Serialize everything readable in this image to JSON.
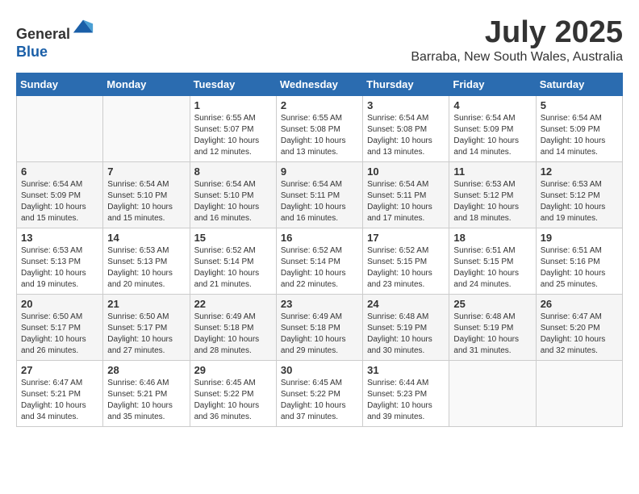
{
  "header": {
    "logo_line1": "General",
    "logo_line2": "Blue",
    "month_year": "July 2025",
    "location": "Barraba, New South Wales, Australia"
  },
  "weekdays": [
    "Sunday",
    "Monday",
    "Tuesday",
    "Wednesday",
    "Thursday",
    "Friday",
    "Saturday"
  ],
  "weeks": [
    [
      {
        "day": "",
        "info": ""
      },
      {
        "day": "",
        "info": ""
      },
      {
        "day": "1",
        "info": "Sunrise: 6:55 AM\nSunset: 5:07 PM\nDaylight: 10 hours and 12 minutes."
      },
      {
        "day": "2",
        "info": "Sunrise: 6:55 AM\nSunset: 5:08 PM\nDaylight: 10 hours and 13 minutes."
      },
      {
        "day": "3",
        "info": "Sunrise: 6:54 AM\nSunset: 5:08 PM\nDaylight: 10 hours and 13 minutes."
      },
      {
        "day": "4",
        "info": "Sunrise: 6:54 AM\nSunset: 5:09 PM\nDaylight: 10 hours and 14 minutes."
      },
      {
        "day": "5",
        "info": "Sunrise: 6:54 AM\nSunset: 5:09 PM\nDaylight: 10 hours and 14 minutes."
      }
    ],
    [
      {
        "day": "6",
        "info": "Sunrise: 6:54 AM\nSunset: 5:09 PM\nDaylight: 10 hours and 15 minutes."
      },
      {
        "day": "7",
        "info": "Sunrise: 6:54 AM\nSunset: 5:10 PM\nDaylight: 10 hours and 15 minutes."
      },
      {
        "day": "8",
        "info": "Sunrise: 6:54 AM\nSunset: 5:10 PM\nDaylight: 10 hours and 16 minutes."
      },
      {
        "day": "9",
        "info": "Sunrise: 6:54 AM\nSunset: 5:11 PM\nDaylight: 10 hours and 16 minutes."
      },
      {
        "day": "10",
        "info": "Sunrise: 6:54 AM\nSunset: 5:11 PM\nDaylight: 10 hours and 17 minutes."
      },
      {
        "day": "11",
        "info": "Sunrise: 6:53 AM\nSunset: 5:12 PM\nDaylight: 10 hours and 18 minutes."
      },
      {
        "day": "12",
        "info": "Sunrise: 6:53 AM\nSunset: 5:12 PM\nDaylight: 10 hours and 19 minutes."
      }
    ],
    [
      {
        "day": "13",
        "info": "Sunrise: 6:53 AM\nSunset: 5:13 PM\nDaylight: 10 hours and 19 minutes."
      },
      {
        "day": "14",
        "info": "Sunrise: 6:53 AM\nSunset: 5:13 PM\nDaylight: 10 hours and 20 minutes."
      },
      {
        "day": "15",
        "info": "Sunrise: 6:52 AM\nSunset: 5:14 PM\nDaylight: 10 hours and 21 minutes."
      },
      {
        "day": "16",
        "info": "Sunrise: 6:52 AM\nSunset: 5:14 PM\nDaylight: 10 hours and 22 minutes."
      },
      {
        "day": "17",
        "info": "Sunrise: 6:52 AM\nSunset: 5:15 PM\nDaylight: 10 hours and 23 minutes."
      },
      {
        "day": "18",
        "info": "Sunrise: 6:51 AM\nSunset: 5:15 PM\nDaylight: 10 hours and 24 minutes."
      },
      {
        "day": "19",
        "info": "Sunrise: 6:51 AM\nSunset: 5:16 PM\nDaylight: 10 hours and 25 minutes."
      }
    ],
    [
      {
        "day": "20",
        "info": "Sunrise: 6:50 AM\nSunset: 5:17 PM\nDaylight: 10 hours and 26 minutes."
      },
      {
        "day": "21",
        "info": "Sunrise: 6:50 AM\nSunset: 5:17 PM\nDaylight: 10 hours and 27 minutes."
      },
      {
        "day": "22",
        "info": "Sunrise: 6:49 AM\nSunset: 5:18 PM\nDaylight: 10 hours and 28 minutes."
      },
      {
        "day": "23",
        "info": "Sunrise: 6:49 AM\nSunset: 5:18 PM\nDaylight: 10 hours and 29 minutes."
      },
      {
        "day": "24",
        "info": "Sunrise: 6:48 AM\nSunset: 5:19 PM\nDaylight: 10 hours and 30 minutes."
      },
      {
        "day": "25",
        "info": "Sunrise: 6:48 AM\nSunset: 5:19 PM\nDaylight: 10 hours and 31 minutes."
      },
      {
        "day": "26",
        "info": "Sunrise: 6:47 AM\nSunset: 5:20 PM\nDaylight: 10 hours and 32 minutes."
      }
    ],
    [
      {
        "day": "27",
        "info": "Sunrise: 6:47 AM\nSunset: 5:21 PM\nDaylight: 10 hours and 34 minutes."
      },
      {
        "day": "28",
        "info": "Sunrise: 6:46 AM\nSunset: 5:21 PM\nDaylight: 10 hours and 35 minutes."
      },
      {
        "day": "29",
        "info": "Sunrise: 6:45 AM\nSunset: 5:22 PM\nDaylight: 10 hours and 36 minutes."
      },
      {
        "day": "30",
        "info": "Sunrise: 6:45 AM\nSunset: 5:22 PM\nDaylight: 10 hours and 37 minutes."
      },
      {
        "day": "31",
        "info": "Sunrise: 6:44 AM\nSunset: 5:23 PM\nDaylight: 10 hours and 39 minutes."
      },
      {
        "day": "",
        "info": ""
      },
      {
        "day": "",
        "info": ""
      }
    ]
  ]
}
